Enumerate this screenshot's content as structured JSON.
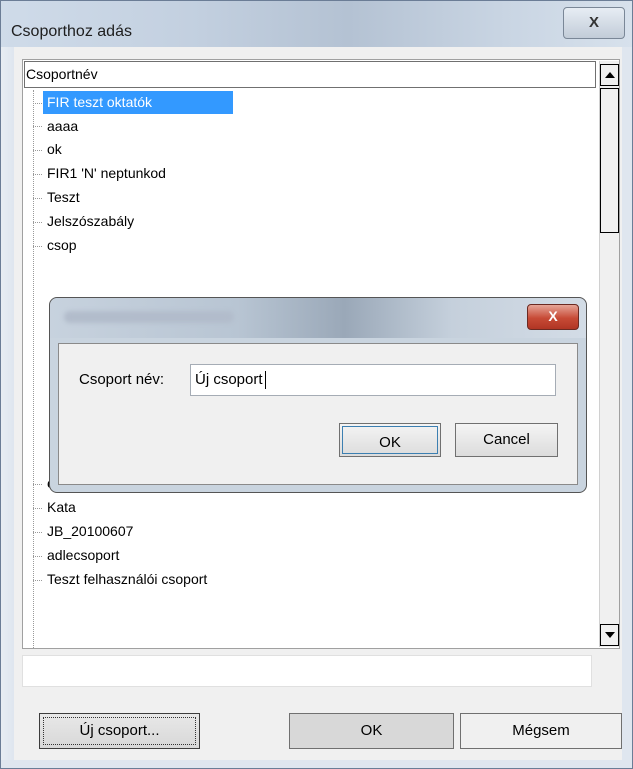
{
  "window": {
    "title": "Csoporthoz adás",
    "close_glyph": "X"
  },
  "tree": {
    "header": "Csoportnév",
    "items": [
      "FIR teszt oktatók",
      "aaaa",
      "ok",
      "FIR1 'N' neptunkod",
      "Teszt",
      "Jelszószabály",
      "csop",
      "",
      "",
      "",
      "",
      "",
      "",
      "",
      "elokep",
      "Kata",
      "JB_20100607",
      "adlecsoport",
      "Teszt felhasználói csoport"
    ],
    "selected_index": 0
  },
  "buttons": {
    "new_group": "Új csoport...",
    "ok": "OK",
    "cancel": "Mégsem"
  },
  "dialog": {
    "close_glyph": "X",
    "label": "Csoport név:",
    "input_value": "Új csoport",
    "ok": "OK",
    "cancel": "Cancel"
  },
  "colors": {
    "selection": "#3399ff",
    "dialog_close": "#c74a36"
  }
}
